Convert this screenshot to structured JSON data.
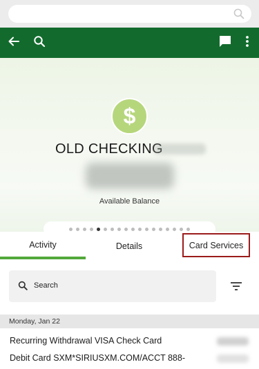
{
  "app_bar": {
    "background_color": "#126b2d",
    "icons": [
      "back-arrow-icon",
      "search-icon",
      "chat-icon",
      "more-vert-icon"
    ]
  },
  "account": {
    "icon": "dollar-sign-icon",
    "icon_symbol": "$",
    "name": "OLD CHECKING",
    "balance_label": "Available Balance"
  },
  "pager": {
    "dot_count": 18,
    "active_index": 4
  },
  "tabs": [
    {
      "label": "Activity",
      "active": true
    },
    {
      "label": "Details",
      "active": false
    },
    {
      "label": "Card Services",
      "active": false,
      "highlighted": true
    }
  ],
  "search": {
    "placeholder": "Search"
  },
  "transactions": {
    "date_header": "Monday, Jan 22",
    "items": [
      {
        "title": "Recurring Withdrawal VISA Check Card",
        "description": "Debit Card SXM*SIRIUSXM.COM/ACCT 888-"
      }
    ]
  },
  "colors": {
    "accent_green": "#52a83a",
    "badge_green": "#b6d67c",
    "highlight_red": "#9b1b1b"
  }
}
